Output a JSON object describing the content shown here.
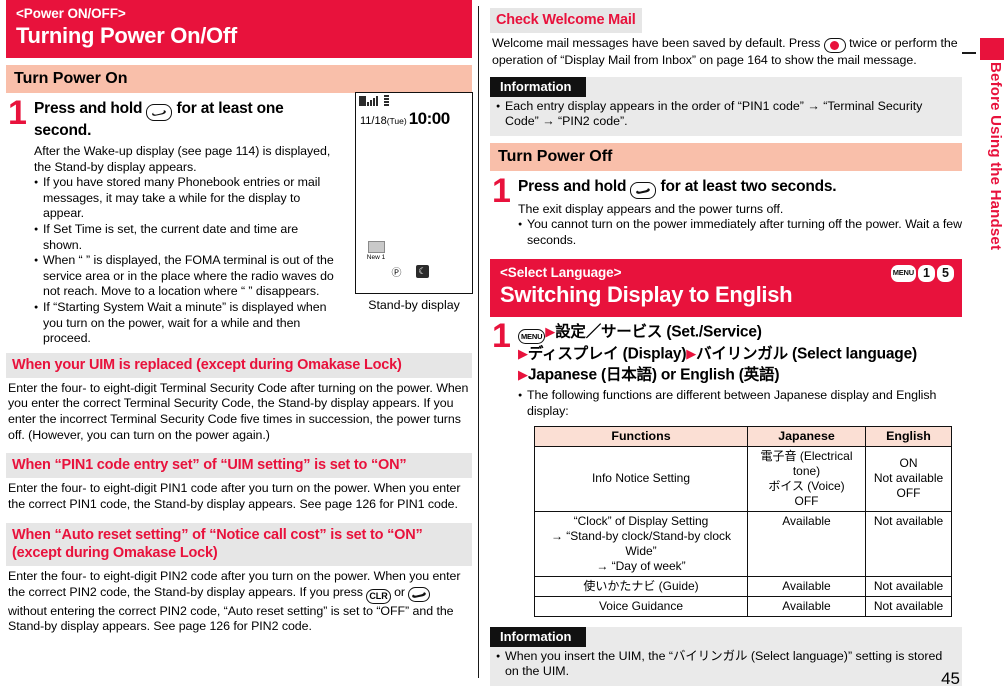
{
  "page_number": "45",
  "side_tab": {
    "label": "Before Using the Handset",
    "color": "#e8123c"
  },
  "left": {
    "banner": {
      "kicker": "<Power ON/OFF>",
      "title": "Turning Power On/Off"
    },
    "section_turn_on": "Turn Power On",
    "step1": {
      "number": "1",
      "lead_before": "Press and hold",
      "key_label": "power-end-key",
      "lead_after": "for at least one second.",
      "intro": "After the Wake-up display (see page 114) is displayed, the Stand-by display appears.",
      "bullets": [
        "If you have stored many Phonebook entries or mail messages, it may take a while for the display to appear.",
        "If Set Time is set, the current date and time are shown.",
        "When “ ” is displayed, the FOMA terminal is out of the service area or in the place where the radio waves do not reach. Move to a location where “ ” disappears.",
        "If “Starting System Wait a minute” is displayed when you turn on the power, wait for a while and then proceed."
      ]
    },
    "figure": {
      "caption": "Stand-by display",
      "date": "11/18",
      "day_of_week": "(Tue)",
      "time": "10:00",
      "new_mail_label": "New 1"
    },
    "sub1": {
      "heading": "When your UIM is replaced (except during Omakase Lock)",
      "body": "Enter the four- to eight-digit Terminal Security Code after turning on the power. When you enter the correct Terminal Security Code, the Stand-by display appears. If you enter the incorrect Terminal Security Code five times in succession, the power turns off. (However, you can turn on the power again.)"
    },
    "sub2": {
      "heading": "When “PIN1 code entry set” of “UIM setting” is set to “ON”",
      "body": "Enter the four- to eight-digit PIN1 code after you turn on the power. When you enter the correct PIN1 code, the Stand-by display appears. See page 126 for PIN1 code."
    },
    "sub3": {
      "heading_line1": "When “Auto reset setting” of “Notice call cost” is set to “ON”",
      "heading_line2": "(except during Omakase Lock)",
      "body_part1": "Enter the four- to eight-digit PIN2 code after you turn on the power. When you enter the correct PIN2 code, the Stand-by display appears. If you press",
      "key1": "CLR",
      "body_part2": "or",
      "key2": "power-end-key",
      "body_part3": "without entering the correct PIN2 code, “Auto reset setting” is set to “OFF” and the Stand-by display appears. See page 126 for PIN2 code."
    }
  },
  "right": {
    "welcome": {
      "heading": "Check Welcome Mail",
      "body_part1": "Welcome mail messages have been saved by default. Press",
      "key": "center-select-key",
      "body_part2": "twice or perform the operation of “Display Mail from Inbox” on page 164 to show the mail message."
    },
    "info1": {
      "tag": "Information",
      "bullets": [
        "Each entry display appears in the order of “PIN1 code” → “Terminal Security Code” → “PIN2 code”."
      ]
    },
    "section_turn_off": "Turn Power Off",
    "step_off": {
      "number": "1",
      "lead_before": "Press and hold",
      "key_label": "power-end-key",
      "lead_after": "for at least two seconds.",
      "intro": "The exit display appears and the power turns off.",
      "bullets": [
        "You cannot turn on the power immediately after turning off the power. Wait a few seconds."
      ]
    },
    "banner2": {
      "kicker": "<Select Language>",
      "title": "Switching Display to English",
      "keys": [
        "MENU",
        "1",
        "5"
      ]
    },
    "step_lang": {
      "number": "1",
      "line1": "設定／サービス (Set./Service)",
      "line2a": "ディスプレイ (Display)",
      "line2b": "バイリンガル (Select language)",
      "line3": "Japanese (日本語) or English (英語)",
      "bullets": [
        "The following functions are different between Japanese display and English display:"
      ]
    },
    "table": {
      "headers": [
        "Functions",
        "Japanese",
        "English"
      ],
      "rows": [
        {
          "functions": "Info Notice Setting",
          "japanese": "電子音 (Electrical tone)\nボイス (Voice)\nOFF",
          "english": "ON\nNot available\nOFF"
        },
        {
          "functions": "“Clock” of Display Setting\n→ “Stand-by clock/Stand-by clock Wide”\n→ “Day of week”",
          "japanese": "Available",
          "english": "Not available"
        },
        {
          "functions": "使いかたナビ (Guide)",
          "japanese": "Available",
          "english": "Not available"
        },
        {
          "functions": "Voice Guidance",
          "japanese": "Available",
          "english": "Not available"
        }
      ]
    },
    "info2": {
      "tag": "Information",
      "bullets": [
        "When you insert the UIM, the “バイリンガル (Select language)” setting is stored on the UIM."
      ]
    }
  }
}
